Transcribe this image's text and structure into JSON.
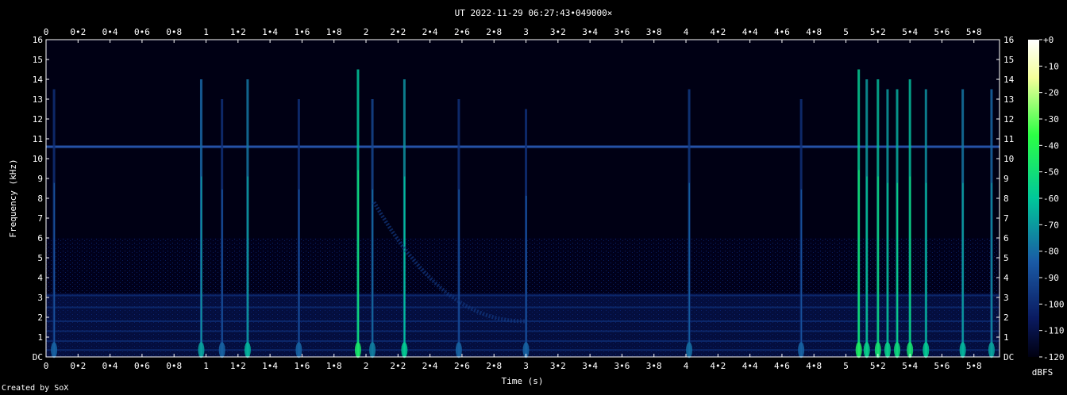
{
  "chart_data": {
    "type": "heatmap",
    "title": "UT 2022-11-29 06:27:43•049000×",
    "xlabel": "Time (s)",
    "ylabel": "Frequency (kHz)",
    "xlim": [
      0,
      5.96
    ],
    "ylim": [
      0,
      16
    ],
    "x_ticks": [
      "0",
      "0•2",
      "0•4",
      "0•6",
      "0•8",
      "1",
      "1•2",
      "1•4",
      "1•6",
      "1•8",
      "2",
      "2•2",
      "2•4",
      "2•6",
      "2•8",
      "3",
      "3•2",
      "3•4",
      "3•6",
      "3•8",
      "4",
      "4•2",
      "4•4",
      "4•6",
      "4•8",
      "5",
      "5•2",
      "5•4",
      "5•6",
      "5•8"
    ],
    "y_ticks": [
      "DC",
      "1",
      "2",
      "3",
      "4",
      "5",
      "6",
      "7",
      "8",
      "9",
      "10",
      "11",
      "12",
      "13",
      "14",
      "15",
      "16"
    ],
    "colorbar": {
      "label": "dBFS",
      "ticks": [
        "+0",
        "-10",
        "-20",
        "-30",
        "-40",
        "-50",
        "-60",
        "-70",
        "-80",
        "-90",
        "-100",
        "-110",
        "-120"
      ],
      "range": [
        -120,
        0
      ]
    },
    "hum_line_khz": 10.6,
    "clicks": [
      {
        "t": 0.05,
        "fmax": 13.5,
        "level": -100
      },
      {
        "t": 0.97,
        "fmax": 14.0,
        "level": -88
      },
      {
        "t": 1.1,
        "fmax": 13.0,
        "level": -100
      },
      {
        "t": 1.26,
        "fmax": 14.0,
        "level": -85
      },
      {
        "t": 1.58,
        "fmax": 13.0,
        "level": -100
      },
      {
        "t": 1.95,
        "fmax": 14.5,
        "level": -70
      },
      {
        "t": 2.04,
        "fmax": 13.0,
        "level": -95
      },
      {
        "t": 2.24,
        "fmax": 14.0,
        "level": -80
      },
      {
        "t": 2.58,
        "fmax": 13.0,
        "level": -100
      },
      {
        "t": 3.0,
        "fmax": 12.5,
        "level": -100
      },
      {
        "t": 4.02,
        "fmax": 13.5,
        "level": -98
      },
      {
        "t": 4.72,
        "fmax": 13.0,
        "level": -100
      },
      {
        "t": 5.08,
        "fmax": 14.5,
        "level": -68
      },
      {
        "t": 5.13,
        "fmax": 14.0,
        "level": -78
      },
      {
        "t": 5.2,
        "fmax": 14.0,
        "level": -72
      },
      {
        "t": 5.26,
        "fmax": 13.5,
        "level": -78
      },
      {
        "t": 5.32,
        "fmax": 13.5,
        "level": -75
      },
      {
        "t": 5.4,
        "fmax": 14.0,
        "level": -72
      },
      {
        "t": 5.5,
        "fmax": 13.5,
        "level": -80
      },
      {
        "t": 5.73,
        "fmax": 13.5,
        "level": -85
      },
      {
        "t": 5.91,
        "fmax": 13.5,
        "level": -88
      }
    ],
    "sweep": {
      "t_start": 2.05,
      "f_start": 7.8,
      "t_end": 3.0,
      "f_end": 1.8,
      "level": -98
    }
  },
  "footer": {
    "credit": "Created by SoX"
  }
}
